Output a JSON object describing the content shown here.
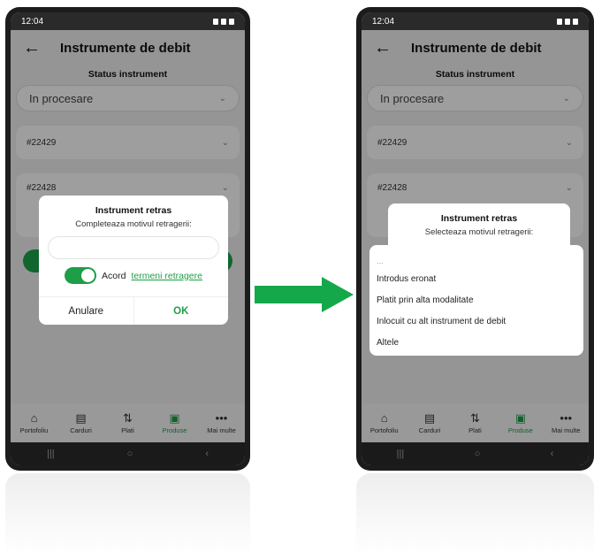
{
  "left_phone": {
    "status_time": "12:04",
    "title": "Instrumente de debit",
    "status_section_label": "Status instrument",
    "status_select_value": "In procesare",
    "cards": [
      "#22429",
      "#22428"
    ],
    "dialog": {
      "title": "Instrument retras",
      "subtitle": "Completeaza motivul retragerii:",
      "agree_text": "Acord",
      "agree_link": "termeni retragere",
      "cancel_label": "Anulare",
      "ok_label": "OK"
    }
  },
  "right_phone": {
    "status_time": "12:04",
    "title": "Instrumente de debit",
    "status_section_label": "Status instrument",
    "status_select_value": "In procesare",
    "cards": [
      "#22429",
      "#22428"
    ],
    "dialog": {
      "title": "Instrument retras",
      "subtitle": "Selecteaza motivul retragerii:"
    },
    "reason_options": [
      "...",
      "Introdus eronat",
      "Platit prin alta modalitate",
      "Inlocuit cu alt instrument de debit",
      "Altele"
    ]
  },
  "bottom_nav": [
    "Portofoliu",
    "Carduri",
    "Plati",
    "Produse",
    "Mai multe"
  ],
  "colors": {
    "accent_green": "#1e9e48",
    "arrow_green": "#14a84a"
  }
}
